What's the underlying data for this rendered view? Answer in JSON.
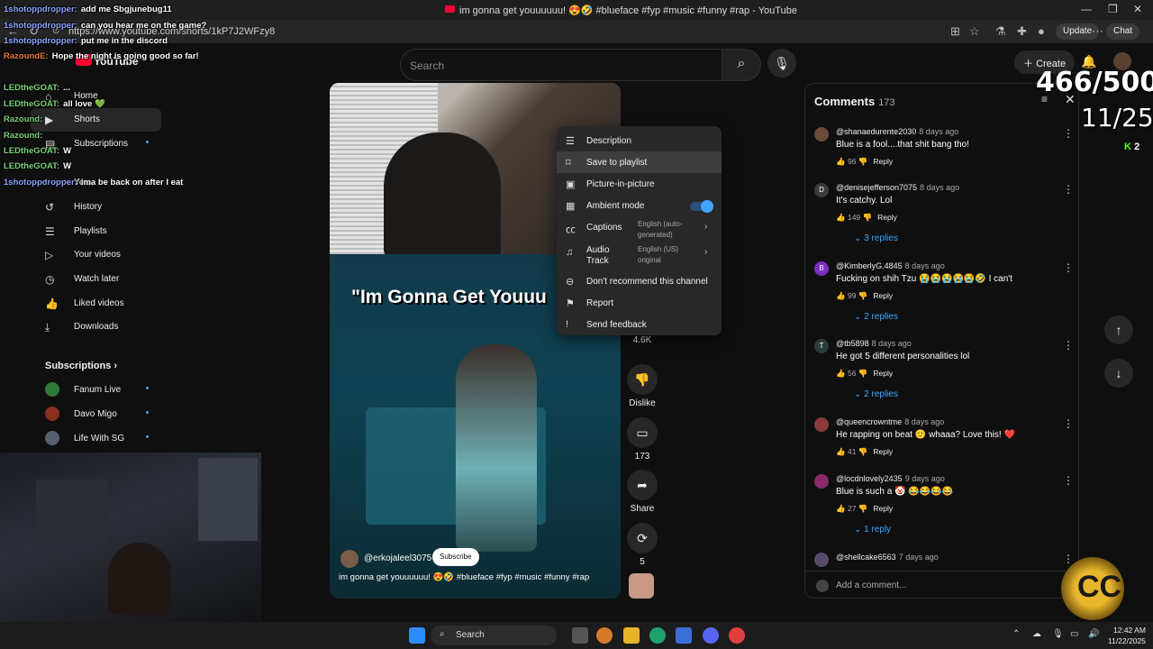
{
  "browser": {
    "tab_title": "im gonna get youuuuuu! 😍🤣 #blueface #fyp #music #funny #rap - YouTube",
    "url": "https://www.youtube.com/shorts/1kP7J2WFzy8",
    "update_label": "Update",
    "chat_label": "Chat"
  },
  "header": {
    "logo": "YouTube",
    "search_placeholder": "Search",
    "create_label": "Create"
  },
  "sidebar": {
    "items": [
      {
        "label": "Home",
        "icon": "home-icon"
      },
      {
        "label": "Shorts",
        "icon": "shorts-icon"
      },
      {
        "label": "Subscriptions",
        "icon": "subscriptions-icon"
      },
      {
        "label": "You",
        "icon": "you-icon"
      },
      {
        "label": "History",
        "icon": "history-icon"
      },
      {
        "label": "Playlists",
        "icon": "playlists-icon"
      },
      {
        "label": "Your videos",
        "icon": "your-videos-icon"
      },
      {
        "label": "Watch later",
        "icon": "watch-later-icon"
      },
      {
        "label": "Liked videos",
        "icon": "liked-videos-icon"
      },
      {
        "label": "Downloads",
        "icon": "downloads-icon"
      }
    ],
    "subscriptions_heading": "Subscriptions",
    "subscriptions": [
      {
        "label": "Fanum Live"
      },
      {
        "label": "Davo Migo"
      },
      {
        "label": "Life With SG"
      }
    ]
  },
  "chat": [
    {
      "user": "1shotoppdropper:",
      "msg": "add me Sbgjunebug11"
    },
    {
      "user": "1shotoppdropper:",
      "msg": "can you hear me on the game?"
    },
    {
      "user": "1shotoppdropper:",
      "msg": "put me in the discord"
    },
    {
      "user": "RazoundE:",
      "msg": "Hope the night is going good so far!"
    },
    {
      "user": "LEDtheGOAT:",
      "msg": "..."
    },
    {
      "user": "LEDtheGOAT:",
      "msg": "all love 💚"
    },
    {
      "user": "Razound:",
      "msg": ""
    },
    {
      "user": "Razound:",
      "msg": ""
    },
    {
      "user": "LEDtheGOAT:",
      "msg": "W"
    },
    {
      "user": "LEDtheGOAT:",
      "msg": "W"
    },
    {
      "user": "1shotoppdropper:",
      "msg": "ima be back on after I eat"
    }
  ],
  "video": {
    "caption": "\"Im Gonna Get Youuu",
    "channel": "@erkojaleel3075",
    "subscribe_label": "Subscribe",
    "title": "im gonna get youuuuuu! 😍🤣 #blueface #fyp #music #funny #rap"
  },
  "actions": {
    "likes": "4.6K",
    "dislike_label": "Dislike",
    "comments_count": "173",
    "share_label": "Share",
    "remix_count": "5"
  },
  "menu": {
    "items": [
      {
        "label": "Description",
        "icon": "description-icon"
      },
      {
        "label": "Save to playlist",
        "icon": "save-playlist-icon"
      },
      {
        "label": "Picture-in-picture",
        "icon": "pip-icon"
      },
      {
        "label": "Ambient mode",
        "icon": "ambient-mode-icon"
      },
      {
        "label": "Captions",
        "icon": "captions-icon",
        "sub": "English (auto-generated)"
      },
      {
        "label": "Audio Track",
        "icon": "audio-track-icon",
        "sub": "English (US) original"
      },
      {
        "label": "Don't recommend this channel",
        "icon": "dont-recommend-icon"
      },
      {
        "label": "Report",
        "icon": "report-icon"
      },
      {
        "label": "Send feedback",
        "icon": "feedback-icon"
      }
    ],
    "ambient_on": true
  },
  "comments": {
    "title": "Comments",
    "count": "173",
    "add_placeholder": "Add a comment...",
    "list": [
      {
        "user": "@shanaedurente2030",
        "time": "8 days ago",
        "text": "Blue is a fool....that shit bang tho!",
        "likes": "96",
        "replies": "",
        "avatar_color": "#6b4a3a",
        "initial": ""
      },
      {
        "user": "@denisejefferson7075",
        "time": "8 days ago",
        "text": "It's catchy. Lol",
        "likes": "149",
        "replies": "3 replies",
        "avatar_color": "#3a3a3a",
        "initial": "D"
      },
      {
        "user": "@KimberlyG.4845",
        "time": "8 days ago",
        "text": "Fucking  on shih Tzu 😭😭😭😭😭🤣 I can't",
        "likes": "99",
        "replies": "2 replies",
        "avatar_color": "#7b2fbf",
        "initial": "B"
      },
      {
        "user": "@tb5898",
        "time": "8 days ago",
        "text": "He got 5 different personalities lol",
        "likes": "56",
        "replies": "2 replies",
        "avatar_color": "#2b3b3b",
        "initial": "T"
      },
      {
        "user": "@queencrowntme",
        "time": "8 days ago",
        "text": "He rapping on beat 🙂 whaaa? Love this! ❤️",
        "likes": "41",
        "replies": "",
        "avatar_color": "#8a3a3a",
        "initial": ""
      },
      {
        "user": "@locdnlovely2435",
        "time": "9 days ago",
        "text": "Blue is such a 🤡 😂😂😂😂",
        "likes": "27",
        "replies": "1 reply",
        "avatar_color": "#8a2a6a",
        "initial": ""
      },
      {
        "user": "@shellcake6563",
        "time": "7 days ago",
        "text": "",
        "likes": "",
        "replies": "",
        "avatar_color": "#5a4a6a",
        "initial": ""
      }
    ],
    "reply_label": "Reply"
  },
  "stream_overlay": {
    "goal": "466/500",
    "subgoal": "11/25",
    "kick_count": "2"
  },
  "taskbar": {
    "search_label": "Search",
    "time": "12:42 AM",
    "date": "11/22/2025"
  }
}
